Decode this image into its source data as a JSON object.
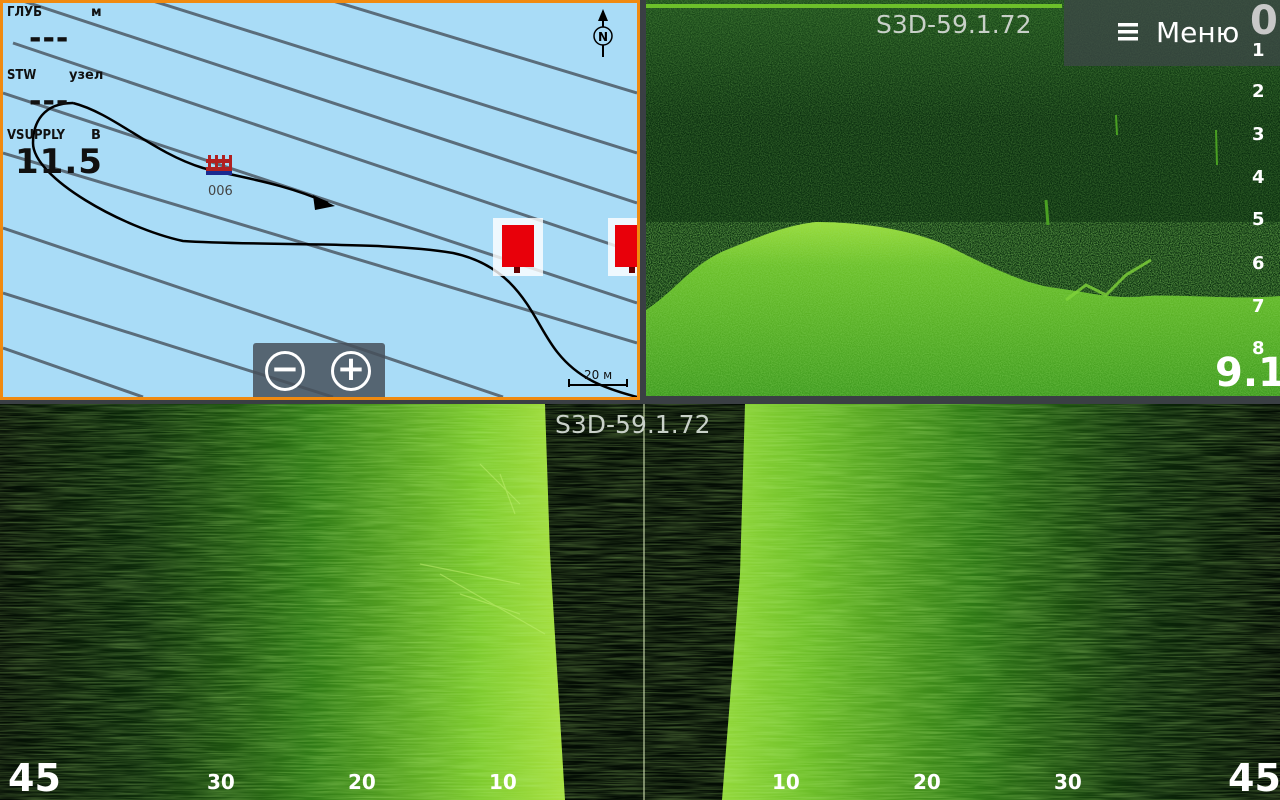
{
  "map": {
    "data_panel": {
      "depth": {
        "label": "ГЛУБ",
        "unit": "м",
        "value": "---"
      },
      "stw": {
        "label": "STW",
        "unit": "узел",
        "value": "---"
      },
      "vsupply": {
        "label": "VSUPPLY",
        "unit": "В",
        "value": "11.5"
      }
    },
    "waypoint_label": "006",
    "north_icon": "north-arrow-icon",
    "scale_label": "20 м",
    "zoom_out_symbol": "−",
    "zoom_in_symbol": "+",
    "accent_color": "#f08a10",
    "water_color": "#a9dcf7",
    "buoy_color": "#e8000a"
  },
  "sonar": {
    "title": "S3D-59.1.72",
    "menu_label": "Меню",
    "depth_scale": [
      "1",
      "2",
      "3",
      "4",
      "5",
      "6",
      "7",
      "8"
    ],
    "depth_scale_top": "0",
    "depth_readout": "9.1",
    "echo_color": "#6cc02a"
  },
  "sidescan": {
    "title": "S3D-59.1.72",
    "range_left": "45",
    "range_right": "45",
    "ticks_left": [
      "30",
      "20",
      "10"
    ],
    "ticks_right": [
      "10",
      "20",
      "30"
    ]
  }
}
